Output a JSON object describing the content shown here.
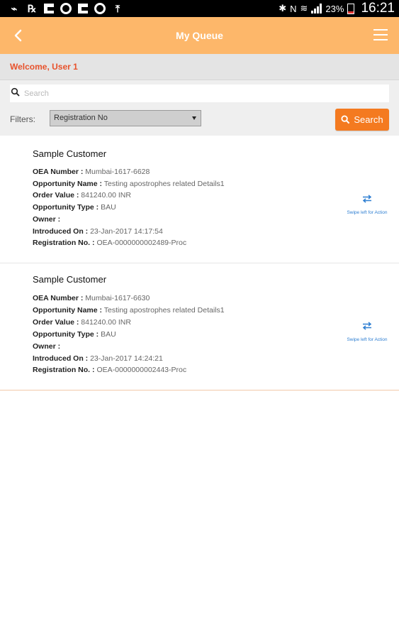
{
  "status_bar": {
    "battery": "23%",
    "time": "16:21"
  },
  "app_bar": {
    "title": "My Queue"
  },
  "welcome": {
    "text": "Welcome, User 1"
  },
  "search": {
    "placeholder": "Search",
    "value": "",
    "filters_label": "Filters:",
    "filter_selected": "Registration No",
    "button_label": "Search"
  },
  "labels": {
    "oea_number": "OEA Number :",
    "opportunity_name": "Opportunity Name :",
    "order_value": "Order Value :",
    "opportunity_type": "Opportunity Type :",
    "owner": "Owner :",
    "introduced_on": "Introduced On :",
    "registration_no": "Registration No. :"
  },
  "queue": [
    {
      "customer": "Sample Customer",
      "oea_number": "Mumbai-1617-6628",
      "opportunity_name": "Testing apostrophes related Details1",
      "order_value": "841240.00 INR",
      "opportunity_type": "BAU",
      "owner": "",
      "introduced_on": "23-Jan-2017 14:17:54",
      "registration_no": "OEA-0000000002489-Proc",
      "swipe_hint": "Swipe left for Action"
    },
    {
      "customer": "Sample Customer",
      "oea_number": "Mumbai-1617-6630",
      "opportunity_name": "Testing apostrophes related Details1",
      "order_value": "841240.00 INR",
      "opportunity_type": "BAU",
      "owner": "",
      "introduced_on": "23-Jan-2017 14:24:21",
      "registration_no": "OEA-0000000002443-Proc",
      "swipe_hint": "Swipe left for Action"
    }
  ],
  "colors": {
    "app_bar": "#fdb76a",
    "accent_button": "#f47a20",
    "welcome_text": "#e8522b",
    "swipe_hint": "#2f7fd2"
  }
}
